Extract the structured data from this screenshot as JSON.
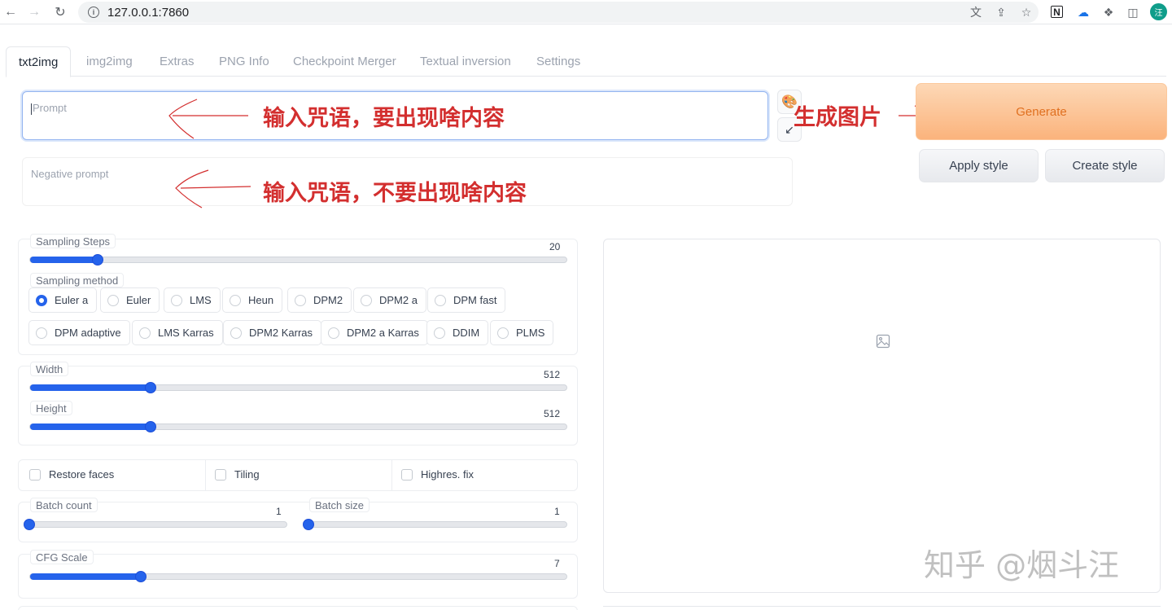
{
  "browser": {
    "url": "127.0.0.1:7860",
    "avatar_text": "汪"
  },
  "tabs": [
    {
      "label": "txt2img",
      "active": true
    },
    {
      "label": "img2img"
    },
    {
      "label": "Extras"
    },
    {
      "label": "PNG Info"
    },
    {
      "label": "Checkpoint Merger"
    },
    {
      "label": "Textual inversion"
    },
    {
      "label": "Settings"
    }
  ],
  "prompt": {
    "placeholder": "Prompt",
    "value": ""
  },
  "negative_prompt": {
    "placeholder": "Negative prompt",
    "value": ""
  },
  "buttons": {
    "generate": "Generate",
    "apply_style": "Apply style",
    "create_style": "Create style"
  },
  "annotations": {
    "prompt_note": "输入咒语，要出现啥内容",
    "negative_note": "输入咒语，不要出现啥内容",
    "generate_note": "生成图片"
  },
  "sampling_steps": {
    "label": "Sampling Steps",
    "value": "20",
    "min": 1,
    "max": 150
  },
  "sampling_method": {
    "label": "Sampling method",
    "selected": "Euler a",
    "options_row1": [
      "Euler a",
      "Euler",
      "LMS",
      "Heun",
      "DPM2",
      "DPM2 a",
      "DPM fast"
    ],
    "options_row2": [
      "DPM adaptive",
      "LMS Karras",
      "DPM2 Karras",
      "DPM2 a Karras",
      "DDIM",
      "PLMS"
    ]
  },
  "width": {
    "label": "Width",
    "value": "512",
    "min": 64,
    "max": 2048
  },
  "height": {
    "label": "Height",
    "value": "512",
    "min": 64,
    "max": 2048
  },
  "checkboxes": {
    "restore_faces": "Restore faces",
    "tiling": "Tiling",
    "highres_fix": "Highres. fix"
  },
  "batch_count": {
    "label": "Batch count",
    "value": "1",
    "min": 1,
    "max": 100
  },
  "batch_size": {
    "label": "Batch size",
    "value": "1",
    "min": 1,
    "max": 8
  },
  "cfg_scale": {
    "label": "CFG Scale",
    "value": "7",
    "min": 1,
    "max": 30
  },
  "watermark": "知乎 @烟斗汪",
  "colors": {
    "accent": "#2563eb",
    "annotation": "#d32f2f",
    "generate_text": "#e07020"
  }
}
